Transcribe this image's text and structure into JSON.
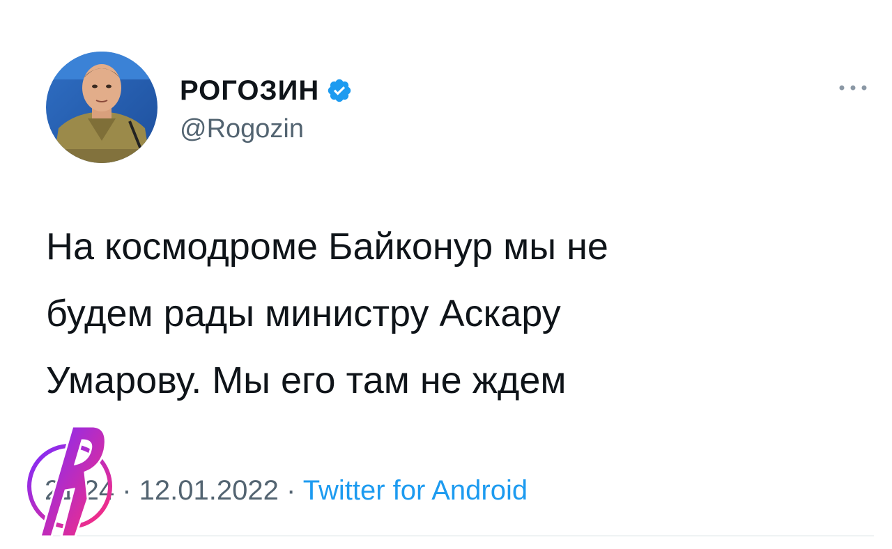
{
  "tweet": {
    "author": {
      "display_name": "РОГОЗИН",
      "handle": "@Rogozin",
      "verified": true,
      "avatar_icon": "profile-photo"
    },
    "text": "На космодроме Байконур мы не\nбудем рады министру Аскару\nУмарову. Мы его там не ждем",
    "meta": {
      "time": "21:24",
      "separator": "·",
      "date": "12.01.2022",
      "source": "Twitter for Android"
    }
  },
  "icons": {
    "more": "more-dots-icon",
    "verified": "verified-badge-icon",
    "watermark": "channel-logo-watermark"
  },
  "colors": {
    "text": "#0f1419",
    "secondary": "#536471",
    "accent": "#1d9bf0",
    "divider": "#eff3f4",
    "watermark_gradient": [
      "#7b2cff",
      "#ff2d7a"
    ]
  }
}
